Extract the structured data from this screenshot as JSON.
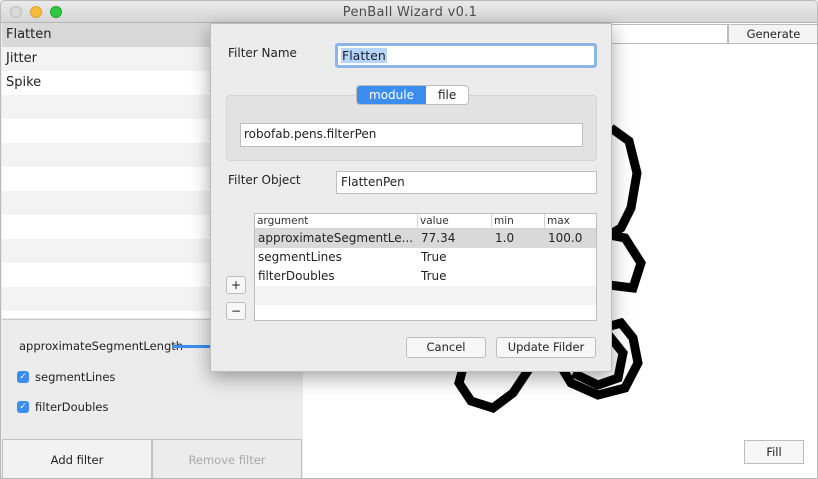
{
  "window": {
    "title": "PenBall Wizard v0.1"
  },
  "filters": {
    "items": [
      "Flatten",
      "Jitter",
      "Spike"
    ],
    "selected": "Flatten"
  },
  "options": {
    "slider_label": "approximateSegmentLength",
    "checkboxes": [
      {
        "label": "segmentLines",
        "checked": true
      },
      {
        "label": "filterDoubles",
        "checked": true
      }
    ]
  },
  "footer": {
    "add_label": "Add filter",
    "remove_label": "Remove filter"
  },
  "preview": {
    "generate_label": "Generate",
    "fill_label": "Fill"
  },
  "sheet": {
    "filter_name_label": "Filter Name",
    "filter_name_value": "Flatten",
    "segments": [
      "module",
      "file"
    ],
    "active_segment": "module",
    "module_path": "robofab.pens.filterPen",
    "filter_object_label": "Filter Object",
    "filter_object_value": "FlattenPen",
    "table": {
      "headers": [
        "argument",
        "value",
        "min",
        "max"
      ],
      "rows": [
        [
          "approximateSegmentLe...",
          "77.34",
          "1.0",
          "100.0"
        ],
        [
          "segmentLines",
          "True",
          "",
          ""
        ],
        [
          "filterDoubles",
          "True",
          "",
          ""
        ]
      ]
    },
    "add_symbol": "+",
    "remove_symbol": "−",
    "cancel_label": "Cancel",
    "update_label": "Update Filder"
  },
  "colors": {
    "accent": "#3b8ef0",
    "selection": "#d9d9d9"
  }
}
